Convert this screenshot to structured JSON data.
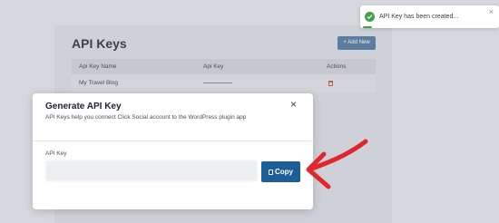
{
  "page": {
    "title": "API Keys",
    "add_new_label": "+ Add New"
  },
  "table": {
    "columns": [
      "Api Key Name",
      "Api Key",
      "Actions"
    ],
    "rows": [
      {
        "name": "My Travel Blog",
        "key": ""
      }
    ]
  },
  "toast": {
    "message": "API Key has been created...",
    "close": "×",
    "icon": "check-circle-icon",
    "color": "#43a04a"
  },
  "modal": {
    "title": "Generate API Key",
    "description": "API Keys help you connect Click Social account to the WordPress plugin app",
    "close": "×",
    "field_label": "API Key",
    "field_value": "",
    "copy_label": "Copy",
    "accent": "#1d5e99"
  },
  "annotation": {
    "arrow_color": "#e0262c"
  }
}
